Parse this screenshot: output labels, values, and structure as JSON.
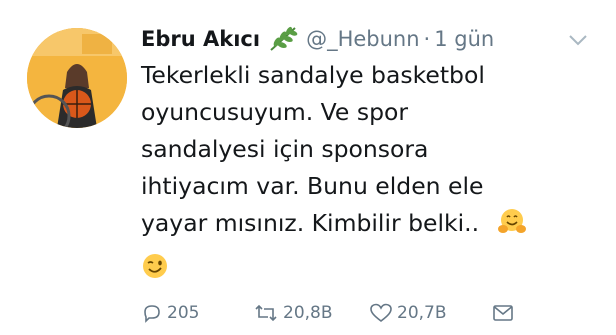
{
  "user": {
    "display_name": "Ebru Akıcı",
    "handle": "@_Hebunn",
    "separator": "·",
    "time": "1 gün"
  },
  "tweet": {
    "lines": [
      "Tekerlekli sandalye basketbol",
      "oyuncusuyum. Ve spor",
      "sandalyesi için sponsora",
      "ihtiyacım var. Bunu elden ele",
      "yayar mısınız. Kimbilir belki.."
    ],
    "emojis": [
      "hugging-face-emoji",
      "winking-face-emoji"
    ]
  },
  "actions": {
    "reply_count": "205",
    "retweet_count": "20,8B",
    "like_count": "20,7B"
  },
  "icons": {
    "verified_like_leaf": "herb-leaf-icon",
    "menu": "chevron-down-icon",
    "reply": "reply-icon",
    "retweet": "retweet-icon",
    "like": "heart-icon",
    "dm": "envelope-icon"
  },
  "colors": {
    "text": "#14171a",
    "muted": "#657786",
    "leaf": "#4a8a3a",
    "avatar_bg": "#f4b53f"
  }
}
